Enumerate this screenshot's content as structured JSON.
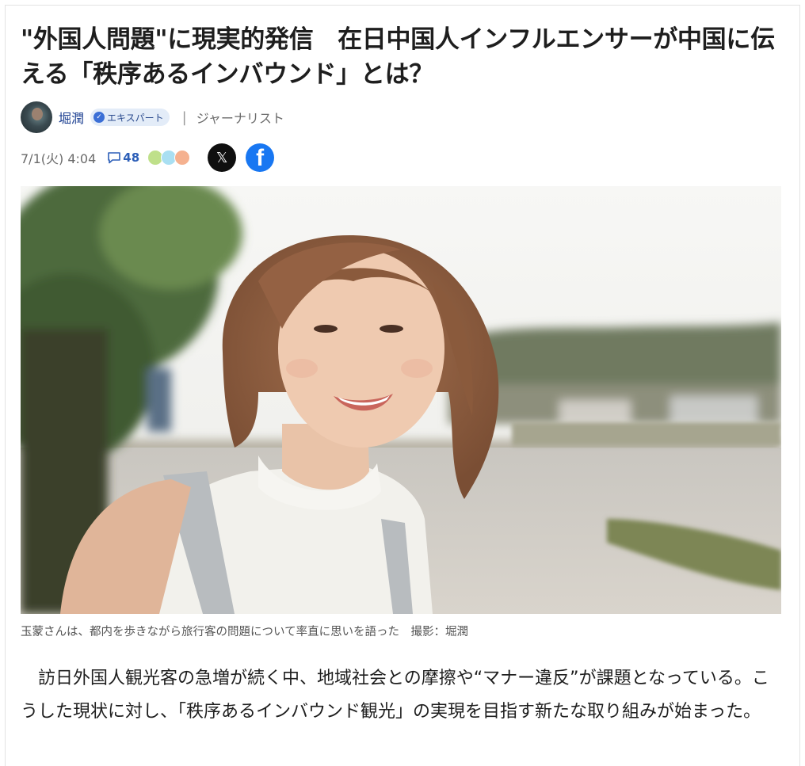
{
  "article": {
    "title": "\"外国人問題\"に現実的発信　在日中国人インフルエンサーが中国に伝える「秩序あるインバウンド」とは？",
    "author": {
      "name": "堀潤",
      "badge": "エキスパート",
      "role": "ジャーナリスト"
    },
    "meta": {
      "date": "7/1(火) 4:04",
      "comment_count": "48"
    },
    "share": {
      "x_label": "𝕏",
      "facebook_label": "f"
    },
    "photo_caption": "玉蒙さんは、都内を歩きながら旅行客の問題について率直に思いを語った　撮影：堀潤",
    "body_text": "訪日外国人観光客の急増が続く中、地域社会との摩擦や“マナー違反”が課題となっている。こうした現状に対し、「秩序あるインバウンド観光」の実現を目指す新たな取り組みが始まった。"
  },
  "icons": {
    "avatar": "author-avatar",
    "verified": "verified-check-icon",
    "comment": "comment-bubble-icon",
    "reactions": [
      "smile-face-icon",
      "neutral-face-icon",
      "sad-face-icon"
    ]
  },
  "colors": {
    "author_link": "#173b8f",
    "badge_bg": "#e3ecf8",
    "comment_accent": "#2d5fb8",
    "x_brand": "#0f0f0f",
    "facebook_brand": "#1877f2"
  }
}
